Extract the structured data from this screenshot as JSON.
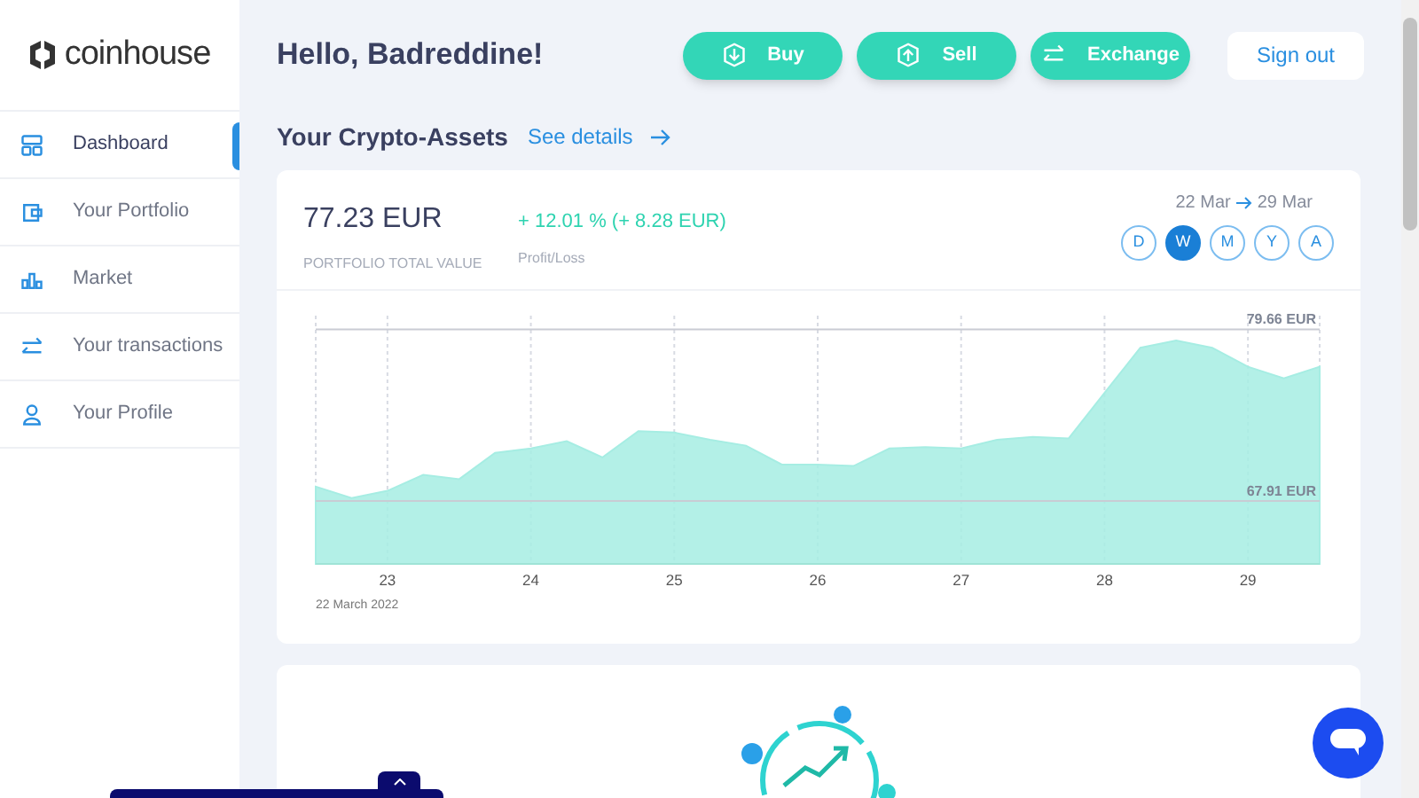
{
  "brand": {
    "name": "coinhouse"
  },
  "sidebar": {
    "items": [
      {
        "label": "Dashboard",
        "selected": true
      },
      {
        "label": "Your Portfolio",
        "selected": false
      },
      {
        "label": "Market",
        "selected": false
      },
      {
        "label": "Your transactions",
        "selected": false
      },
      {
        "label": "Your Profile",
        "selected": false
      }
    ]
  },
  "header": {
    "greeting": "Hello, Badreddine!",
    "actions": [
      {
        "label": "Buy"
      },
      {
        "label": "Sell"
      },
      {
        "label": "Exchange"
      }
    ],
    "sign_out": "Sign out"
  },
  "assets": {
    "title": "Your Crypto-Assets",
    "link": "See details",
    "total": {
      "value": "77.23 EUR",
      "label": "PORTFOLIO TOTAL VALUE"
    },
    "profit": {
      "value": "+ 12.01 % (+ 8.28 EUR)",
      "label": "Profit/Loss"
    },
    "range": {
      "from": "22 Mar",
      "to": "29 Mar"
    },
    "periods": [
      {
        "label": "D",
        "selected": false
      },
      {
        "label": "W",
        "selected": true
      },
      {
        "label": "M",
        "selected": false
      },
      {
        "label": "Y",
        "selected": false
      },
      {
        "label": "A",
        "selected": false
      }
    ],
    "chart_data": {
      "type": "area",
      "x": [
        22.5,
        22.75,
        23,
        23.25,
        23.5,
        23.75,
        24,
        24.25,
        24.5,
        24.75,
        25,
        25.25,
        25.5,
        25.75,
        26,
        26.25,
        26.5,
        26.75,
        27,
        27.25,
        27.5,
        27.75,
        28,
        28.25,
        28.5,
        28.75,
        29,
        29.25,
        29.5
      ],
      "grid": true,
      "series": [
        {
          "color": "#a6ede3",
          "values": [
            68.9,
            68.1,
            68.6,
            69.7,
            69.4,
            71.2,
            71.5,
            72.0,
            70.9,
            72.7,
            72.6,
            72.1,
            71.7,
            70.4,
            70.4,
            70.3,
            71.5,
            71.6,
            71.5,
            72.1,
            72.3,
            72.2,
            75.3,
            78.4,
            78.9,
            78.4,
            77.1,
            76.3,
            77.1
          ]
        }
      ],
      "xlim": [
        22.5,
        29.5
      ],
      "ylim": [
        63.6,
        80.6
      ],
      "xticks": [
        23,
        24,
        25,
        26,
        27,
        28,
        29
      ],
      "yticks": [
        {
          "value": 79.66,
          "label": "79.66 EUR"
        },
        {
          "value": 67.91,
          "label": "67.91 EUR"
        }
      ]
    },
    "start_date": "22 March 2022"
  }
}
